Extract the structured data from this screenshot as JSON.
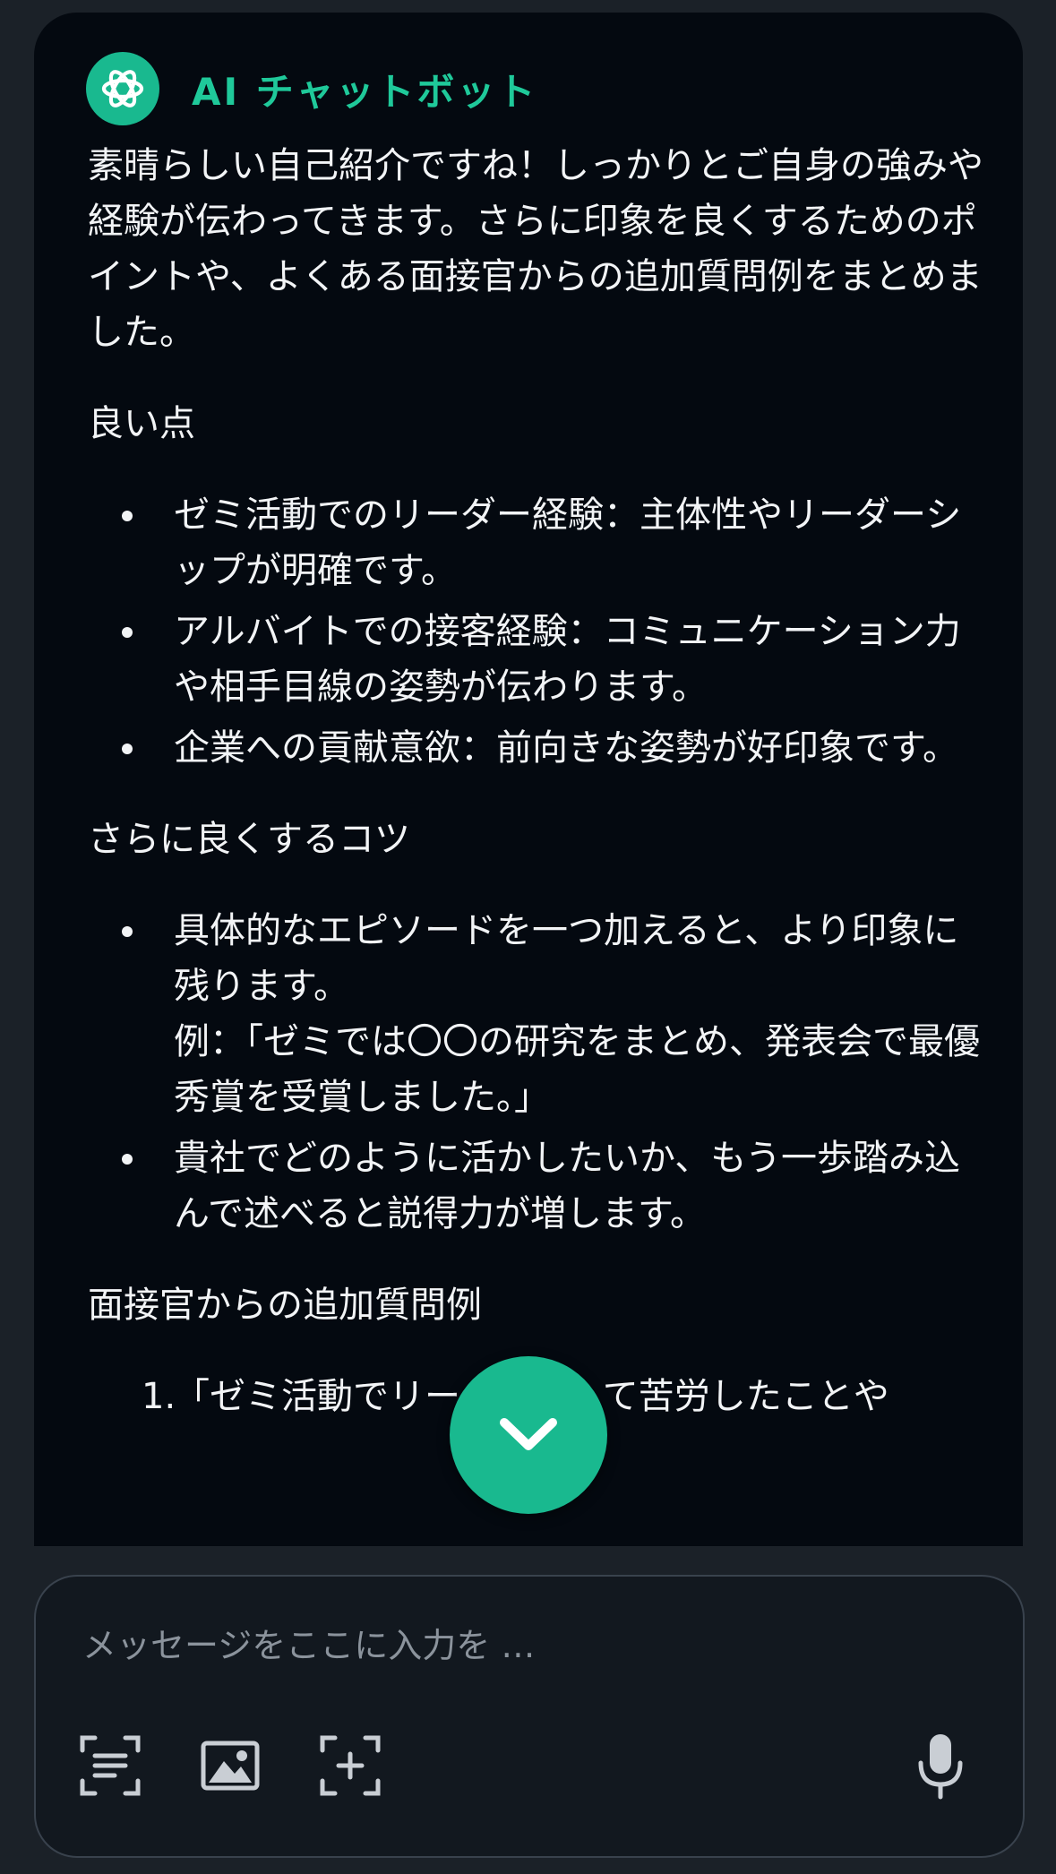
{
  "header": {
    "bot_name": "AI チャットボット",
    "avatar_icon": "openai-logo-icon"
  },
  "message": {
    "intro": "素晴らしい自己紹介ですね！しっかりとご自身の強みや経験が伝わってきます。さらに印象を良くするためのポイントや、よくある面接官からの追加質問例をまとめました。",
    "good_points": {
      "heading": "良い点",
      "items": [
        "ゼミ活動でのリーダー経験：主体性やリーダーシップが明確です。",
        "アルバイトでの接客経験：コミュニケーション力や相手目線の姿勢が伝わります。",
        "企業への貢献意欲：前向きな姿勢が好印象です。"
      ]
    },
    "tips": {
      "heading": "さらに良くするコツ",
      "items": [
        {
          "text": "具体的なエピソードを一つ加えると、より印象に残ります。",
          "example": "例：「ゼミでは〇〇の研究をまとめ、発表会で最優秀賞を受賞しました。」"
        },
        {
          "text": "貴社でどのように活かしたいか、もう一歩踏み込んで述べると説得力が増します。"
        }
      ]
    },
    "questions": {
      "heading": "面接官からの追加質問例",
      "items": [
        {
          "number": "1.",
          "text": "「ゼミ活動でリーダーとして苦労したことや"
        }
      ]
    }
  },
  "scroll_button": {
    "icon": "chevron-down-icon"
  },
  "composer": {
    "placeholder": "メッセージをここに入力を …",
    "tools": [
      "text-scan-icon",
      "image-icon",
      "add-frame-icon",
      "microphone-icon"
    ]
  },
  "colors": {
    "accent": "#19b98f",
    "bot_name": "#1fc99a",
    "chat_background": "#040910",
    "page_background": "#1b2128"
  }
}
